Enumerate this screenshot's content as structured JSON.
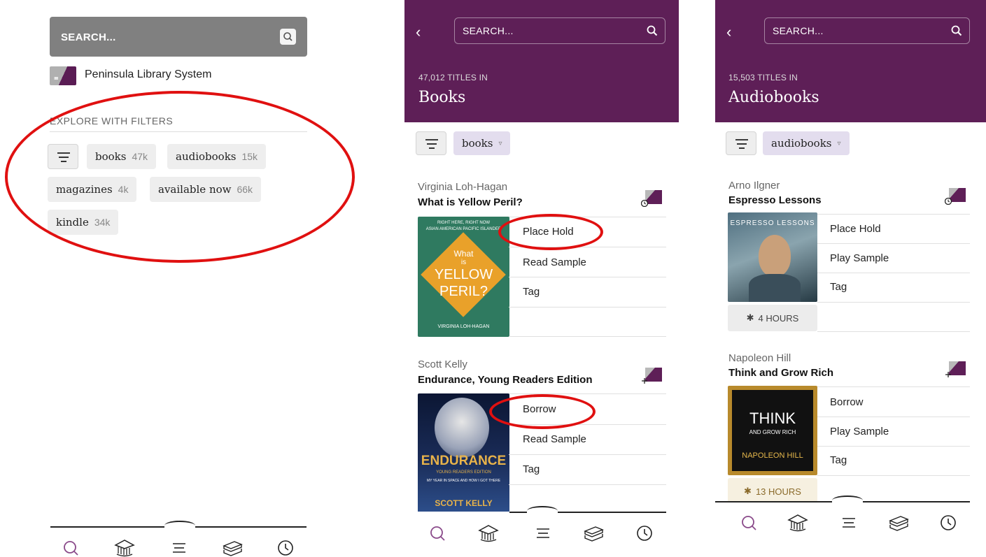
{
  "panel1": {
    "search_placeholder": "SEARCH...",
    "library_name": "Peninsula Library System",
    "library_logo_text": "ıııııı",
    "explore_heading": "EXPLORE WITH FILTERS",
    "chips": [
      {
        "label": "books",
        "count": "47k"
      },
      {
        "label": "audiobooks",
        "count": "15k"
      },
      {
        "label": "magazines",
        "count": "4k"
      },
      {
        "label": "available now",
        "count": "66k"
      },
      {
        "label": "kindle",
        "count": "34k"
      }
    ]
  },
  "panel2": {
    "search_placeholder": "SEARCH...",
    "count_text": "47,012 TITLES IN",
    "title": "Books",
    "filter_chip": "books",
    "items": [
      {
        "author": "Virginia Loh-Hagan",
        "title": "What is Yellow Peril?",
        "actions": [
          "Place Hold",
          "Read Sample",
          "Tag"
        ],
        "cover_top_line1": "RIGHT HERE, RIGHT NOW",
        "cover_top_line2": "ASIAN AMERICAN PACIFIC ISLANDER",
        "cover_word1": "What",
        "cover_word2": "is",
        "cover_word3": "YELLOW",
        "cover_word4": "PERIL?",
        "cover_author": "VIRGINIA LOH-HAGAN"
      },
      {
        "author": "Scott Kelly",
        "title": "Endurance, Young Readers Edition",
        "actions": [
          "Borrow",
          "Read Sample",
          "Tag"
        ],
        "cover_title": "ENDURANCE",
        "cover_sub": "YOUNG READERS EDITION",
        "cover_sub2": "MY YEAR IN SPACE AND HOW I GOT THERE",
        "cover_author": "SCOTT KELLY"
      }
    ]
  },
  "panel3": {
    "search_placeholder": "SEARCH...",
    "count_text": "15,503 TITLES IN",
    "title": "Audiobooks",
    "filter_chip": "audiobooks",
    "items": [
      {
        "author": "Arno Ilgner",
        "title": "Espresso Lessons",
        "actions": [
          "Place Hold",
          "Play Sample",
          "Tag"
        ],
        "duration": "4 HOURS",
        "cover_title": "ESPRESSO LESSONS"
      },
      {
        "author": "Napoleon Hill",
        "title": "Think and Grow Rich",
        "actions": [
          "Borrow",
          "Play Sample",
          "Tag"
        ],
        "duration": "13 HOURS",
        "cover_line1": "THINK",
        "cover_line2": "AND GROW RICH",
        "cover_author": "NAPOLEON HILL"
      }
    ]
  },
  "nav_icons": [
    "search-icon",
    "library-icon",
    "menu-icon",
    "shelf-icon",
    "clock-icon"
  ],
  "colors": {
    "brand_purple": "#5e1f57",
    "annotation_red": "#e01010",
    "chip_grey": "#eeeeee",
    "tag_lavender": "#e3ddee",
    "duration_cream": "#f6f0e0"
  }
}
